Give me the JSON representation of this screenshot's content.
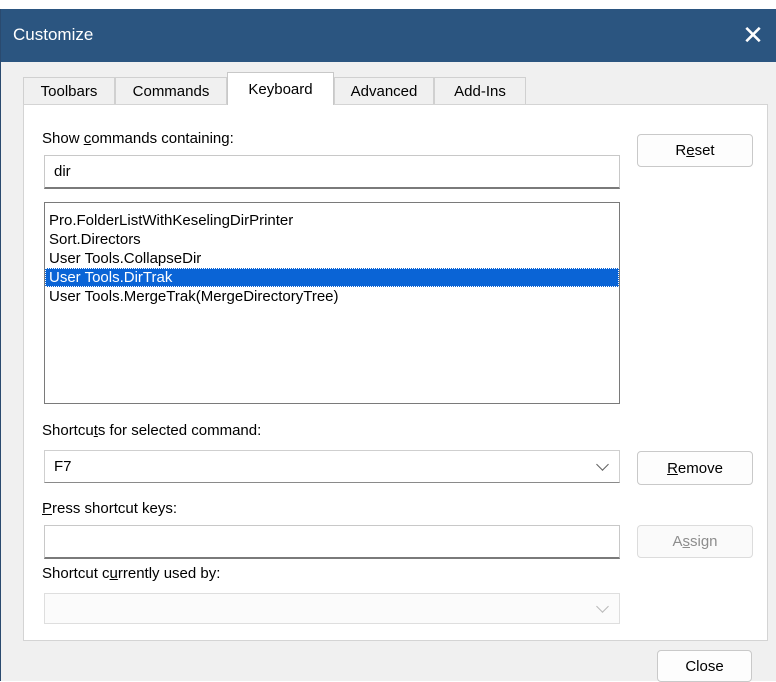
{
  "window": {
    "title": "Customize"
  },
  "tabs": [
    {
      "label": "Toolbars"
    },
    {
      "label": "Commands"
    },
    {
      "label": "Keyboard"
    },
    {
      "label": "Advanced"
    },
    {
      "label": "Add-Ins"
    }
  ],
  "active_tab": "Keyboard",
  "search": {
    "label_pre": "Show ",
    "label_key": "c",
    "label_post": "ommands containing:",
    "value": "dir"
  },
  "commands": {
    "items": [
      "Pro.FolderListWithKeselingDirPrinter",
      "Sort.Directors",
      "User Tools.CollapseDir",
      "User Tools.DirTrak",
      "User Tools.MergeTrak(MergeDirectoryTree)"
    ],
    "selected_index": 3
  },
  "shortcuts": {
    "label_pre": "Shortcu",
    "label_key": "t",
    "label_post": "s for selected command:",
    "value": "F7"
  },
  "press_keys": {
    "label_key": "P",
    "label_post": "ress shortcut keys:",
    "value": ""
  },
  "used_by": {
    "label_pre": "Shortcut c",
    "label_key": "u",
    "label_post": "rrently used by:",
    "value": ""
  },
  "buttons": {
    "reset": {
      "pre": "R",
      "key": "e",
      "post": "set"
    },
    "remove": {
      "pre": "",
      "key": "R",
      "post": "emove"
    },
    "assign": {
      "pre": "A",
      "key": "s",
      "post": "sign"
    },
    "close": "Close"
  },
  "colors": {
    "title_bar": "#2b5580",
    "selection": "#0a64d6"
  }
}
